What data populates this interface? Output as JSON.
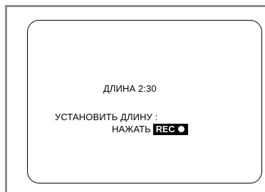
{
  "osd": {
    "length_label": "ДЛИНА",
    "length_value": "2:30",
    "set_length_prompt": "УСТАНОВИТЬ ДЛИНУ :",
    "press_label": "НАЖАТЬ",
    "rec_button_label": "REC",
    "rec_icon": "record-dot-icon"
  },
  "colors": {
    "frame": "#8c8c8c",
    "border": "#000000",
    "text": "#000000",
    "rec_background": "#000000",
    "rec_text": "#ffffff"
  }
}
